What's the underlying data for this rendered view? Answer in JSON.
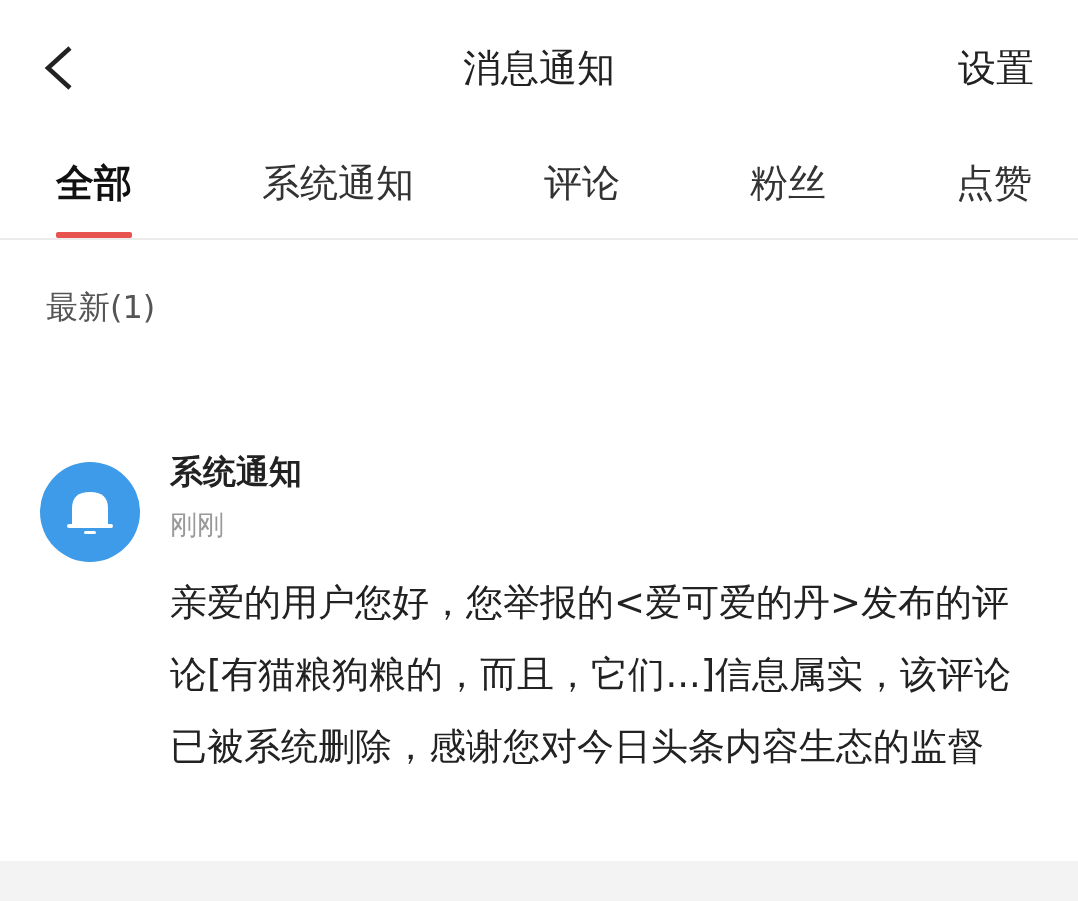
{
  "header": {
    "title": "消息通知",
    "action": "设置"
  },
  "tabs": [
    {
      "label": "全部",
      "selected": true
    },
    {
      "label": "系统通知",
      "selected": false
    },
    {
      "label": "评论",
      "selected": false
    },
    {
      "label": "粉丝",
      "selected": false
    },
    {
      "label": "点赞",
      "selected": false
    }
  ],
  "section": {
    "title": "最新(1)"
  },
  "notifications": [
    {
      "sender": "系统通知",
      "time": "刚刚",
      "message": "亲爱的用户您好，您举报的<爱可爱的丹>发布的评论[有猫粮狗粮的，而且，它们...]信息属实，该评论已被系统删除，感谢您对今日头条内容生态的监督"
    }
  ]
}
